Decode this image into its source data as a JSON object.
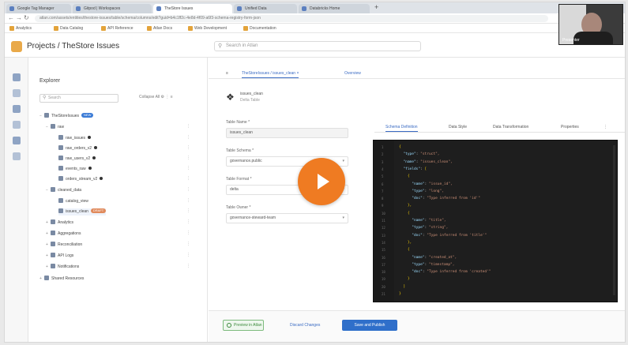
{
  "browser": {
    "tabs": [
      {
        "label": "Google Tag Manager",
        "active": false
      },
      {
        "label": "Gitpod | Workspaces",
        "active": false
      },
      {
        "label": "TheStore Issues",
        "active": true
      },
      {
        "label": "Unified Data",
        "active": false
      },
      {
        "label": "Databricks Home",
        "active": false
      }
    ],
    "url": "atlan.com/assets/entities/thestore-issues/table/schema/columns/edit?guid=b4c1ff2c-4e8d-4f09-a6f3-schema-registry-form-json",
    "bookmarks": [
      "Analytics",
      "Data Catalog",
      "API Reference",
      "Atlan Docs",
      "Web Development",
      "Documentation"
    ]
  },
  "webcam": {
    "name": "Presenter"
  },
  "app": {
    "title": "Projects / TheStore Issues",
    "search_placeholder": "Search in Atlan"
  },
  "explorer": {
    "title": "Explorer",
    "search_placeholder": "Search",
    "tools_label": "Collapse All",
    "tree": [
      {
        "label": "TheStoreIssues",
        "badge": "NEW",
        "depth": 0,
        "toggle": "−"
      },
      {
        "label": "raw",
        "depth": 1,
        "toggle": "−",
        "meta": "⋮"
      },
      {
        "label": "raw_issues",
        "depth": 2,
        "dot": true,
        "meta": "⋮"
      },
      {
        "label": "raw_orders_v2",
        "depth": 2,
        "dot": true,
        "meta": "⋮"
      },
      {
        "label": "raw_users_v2",
        "depth": 2,
        "dot": true,
        "meta": "⋮"
      },
      {
        "label": "events_raw",
        "depth": 2,
        "dot": true,
        "meta": "⋮"
      },
      {
        "label": "orders_stream_v2",
        "depth": 2,
        "dot": true,
        "meta": "⋮"
      },
      {
        "label": "cleaned_data",
        "depth": 1,
        "toggle": "−",
        "meta": "⋮"
      },
      {
        "label": "catalog_view",
        "depth": 2,
        "meta": "⋮"
      },
      {
        "label": "issues_clean",
        "depth": 2,
        "badge2": "DRAFT",
        "meta": "⋮"
      },
      {
        "label": "Analytics",
        "depth": 1,
        "toggle": "+",
        "meta": "⋮"
      },
      {
        "label": "Aggregations",
        "depth": 1,
        "toggle": "+",
        "meta": "⋮"
      },
      {
        "label": "Reconciliation",
        "depth": 1,
        "toggle": "+",
        "meta": "⋮"
      },
      {
        "label": "API Logs",
        "depth": 1,
        "toggle": "+",
        "meta": "⋮"
      },
      {
        "label": "Notifications",
        "depth": 1,
        "toggle": "+",
        "meta": "⋮"
      },
      {
        "label": "Shared Resources",
        "depth": 0,
        "toggle": "+"
      }
    ]
  },
  "main": {
    "subtabs": [
      "TheStoreIssues / issues_clean",
      "Overview"
    ],
    "entity": {
      "name": "issues_clean",
      "type": "Delta Table"
    },
    "fields": [
      {
        "label": "Table Name *",
        "value": "issues_clean",
        "select": false
      },
      {
        "label": "Table Schema *",
        "value": "governance.public",
        "select": true
      },
      {
        "label": "Table Format *",
        "value": "delta",
        "select": true
      },
      {
        "label": "Table Owner *",
        "value": "governance-steward-team",
        "select": true
      }
    ],
    "right_tabs": [
      "Schema Definition",
      "Data Style",
      "Data Transformation",
      "Properties"
    ],
    "code_lines": [
      "{",
      "  \"type\": \"struct\",",
      "  \"name\": \"issues_clean\",",
      "  \"fields\": [",
      "    {",
      "      \"name\": \"issue_id\",",
      "      \"type\": \"long\",",
      "      \"doc\": \"Type inferred from 'id'\"",
      "    },",
      "    {",
      "      \"name\": \"title\",",
      "      \"type\": \"string\",",
      "      \"doc\": \"Type inferred from 'title'\"",
      "    },",
      "    {",
      "      \"name\": \"created_at\",",
      "      \"type\": \"timestamp\",",
      "      \"doc\": \"Type inferred from 'created'\"",
      "    }",
      "  ]",
      "}"
    ],
    "footer": {
      "preview_label": "Preview in Atlan",
      "discard_label": "Discard Changes",
      "save_label": "Save and Publish"
    }
  },
  "colors": {
    "accent": "#2f6fca",
    "play_button": "#ef7b22",
    "editor_bg": "#1e1e1e"
  }
}
